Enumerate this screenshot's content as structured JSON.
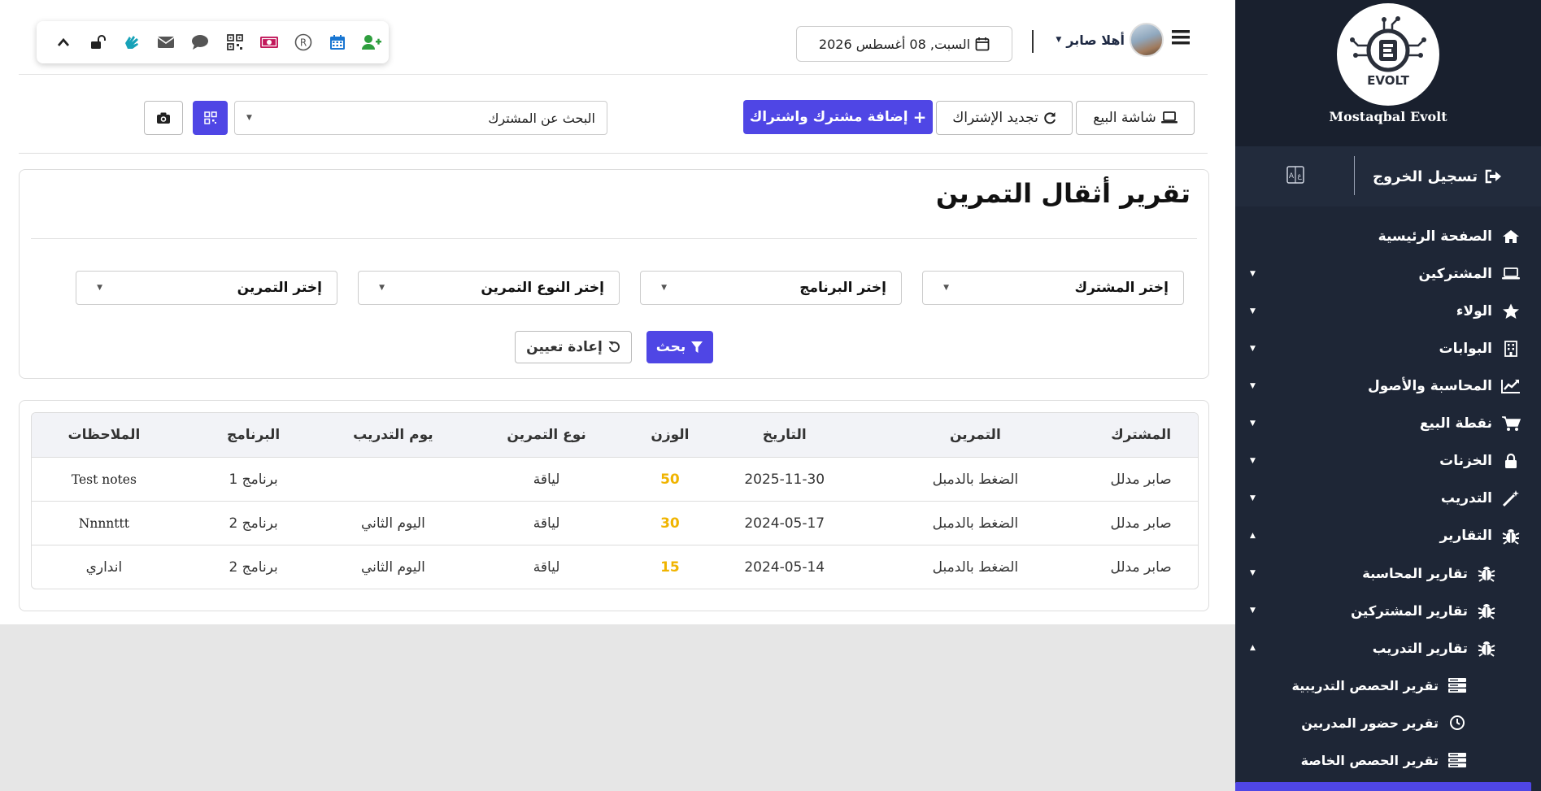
{
  "brand": {
    "logo_text": "EVOLT",
    "name": "Mostaqbal Evolt"
  },
  "sidebar": {
    "logout_label": "تسجيل الخروج",
    "items": [
      {
        "label": "الصفحة الرئيسية",
        "icon": "home-icon",
        "caret": ""
      },
      {
        "label": "المشتركين",
        "icon": "laptop-icon",
        "caret": "▼"
      },
      {
        "label": "الولاء",
        "icon": "star-icon",
        "caret": "▼"
      },
      {
        "label": "البوابات",
        "icon": "building-icon",
        "caret": "▼"
      },
      {
        "label": "المحاسبة والأصول",
        "icon": "chart-line-icon",
        "caret": "▼"
      },
      {
        "label": "نقطة البيع",
        "icon": "cart-icon",
        "caret": "▼"
      },
      {
        "label": "الخزنات",
        "icon": "lock-icon",
        "caret": "▼"
      },
      {
        "label": "التدريب",
        "icon": "magic-wand-icon",
        "caret": "▼"
      },
      {
        "label": "التقارير",
        "icon": "bug-icon",
        "caret": "▲"
      }
    ],
    "sub_items": [
      {
        "label": "تقارير المحاسبة",
        "icon": "bug-icon",
        "caret": "▼"
      },
      {
        "label": "تقارير المشتركين",
        "icon": "bug-icon",
        "caret": "▼"
      },
      {
        "label": "تقارير التدريب",
        "icon": "bug-icon",
        "caret": "▲"
      }
    ],
    "subsub_items": [
      {
        "label": "تقرير الحصص التدريبية",
        "icon": "server-icon"
      },
      {
        "label": "تقرير حضور المدربين",
        "icon": "clock-icon"
      },
      {
        "label": "تقرير الحصص الخاصة",
        "icon": "server-icon"
      }
    ]
  },
  "topbar": {
    "greeting": "أهلا صابر",
    "date": "السبت, 08 أغسطس 2026"
  },
  "actionbar": {
    "pos_label": "شاشة البيع",
    "renew_label": "تجديد الإشتراك",
    "add_label": "إضافة مشترك واشتراك",
    "search_placeholder": "البحث عن المشترك"
  },
  "report": {
    "title": "تقرير أثقال التمرين",
    "filters": {
      "subscriber": "إختر المشترك",
      "program": "إختر البرنامج",
      "exercise_type": "إختر النوع التمرين",
      "exercise": "إختر التمرين"
    },
    "search_label": "بحث",
    "reset_label": "إعادة تعيين"
  },
  "table": {
    "headers": [
      "المشترك",
      "التمرين",
      "التاريخ",
      "الوزن",
      "نوع التمرين",
      "يوم التدريب",
      "البرنامج",
      "الملاحظات"
    ],
    "rows": [
      [
        "صابر مدلل",
        "الضغط بالدمبل",
        "2025-11-30",
        "50",
        "لياقة",
        "",
        "برنامج 1",
        "Test notes"
      ],
      [
        "صابر مدلل",
        "الضغط بالدمبل",
        "2024-05-17",
        "30",
        "لياقة",
        "اليوم الثاني",
        "برنامج 2",
        "Nnnnttt"
      ],
      [
        "صابر مدلل",
        "الضغط بالدمبل",
        "2024-05-14",
        "15",
        "لياقة",
        "اليوم الثاني",
        "برنامج 2",
        "انداري"
      ]
    ]
  },
  "colors": {
    "primary": "#4f46e5",
    "sidebar": "#1e2636",
    "weight": "#f0b400"
  }
}
